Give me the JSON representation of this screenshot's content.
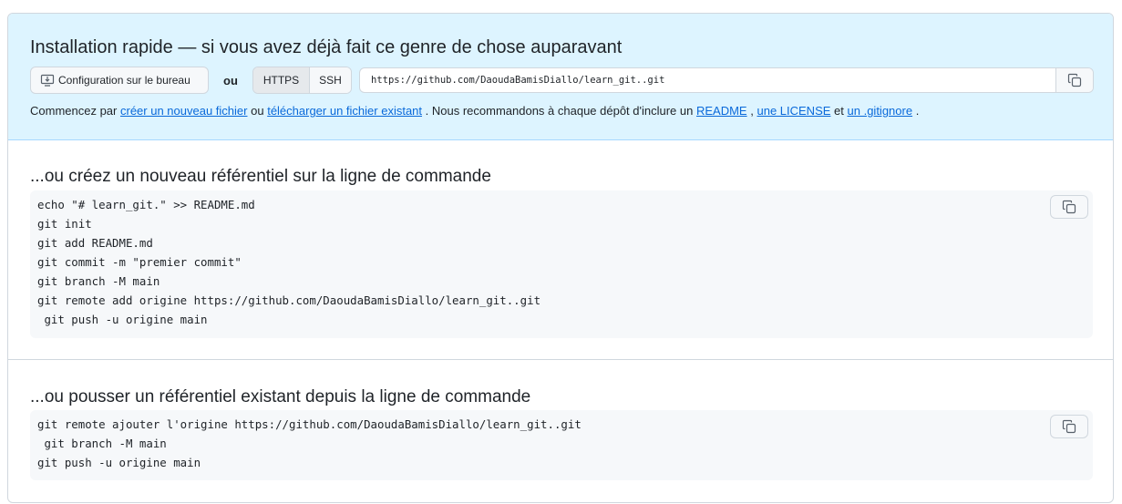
{
  "quick_setup": {
    "title": "Installation rapide — si vous avez déjà fait ce genre de chose auparavant",
    "desktop_button_label": "Configuration sur le bureau",
    "or_label": "ou",
    "protocols": [
      "HTTPS",
      "SSH"
    ],
    "selected_protocol": "HTTPS",
    "clone_url": "https://github.com/DaoudaBamisDiallo/learn_git..git",
    "text_prefix": "Commencez par",
    "link_create_file": "créer un nouveau fichier",
    "text_or": "ou",
    "link_upload_file": "télécharger un fichier existant",
    "text_recommend": ". Nous recommandons à chaque dépôt d'inclure un",
    "link_readme": "README",
    "text_comma": ",",
    "link_license": "une LICENSE",
    "text_and": "et",
    "link_gitignore": "un .gitignore",
    "text_end": "."
  },
  "new_repo": {
    "title": "...ou créez un nouveau référentiel sur la ligne de commande",
    "lines": [
      "echo \"# learn_git.\" >> README.md",
      "git init",
      "git add README.md",
      "git commit -m \"premier commit\"",
      "git branch -M main",
      "git remote add origine https://github.com/DaoudaBamisDiallo/learn_git..git",
      " git push -u origine main"
    ]
  },
  "existing_repo": {
    "title": "...ou pousser un référentiel existant depuis la ligne de commande",
    "lines": [
      "git remote ajouter l'origine https://github.com/DaoudaBamisDiallo/learn_git..git",
      " git branch -M main",
      "git push -u origine main"
    ]
  },
  "colors": {
    "quick_setup_bg": "#ddf4ff",
    "link": "#0969da",
    "code_bg": "#f6f8fa",
    "border": "#d0d7de"
  }
}
